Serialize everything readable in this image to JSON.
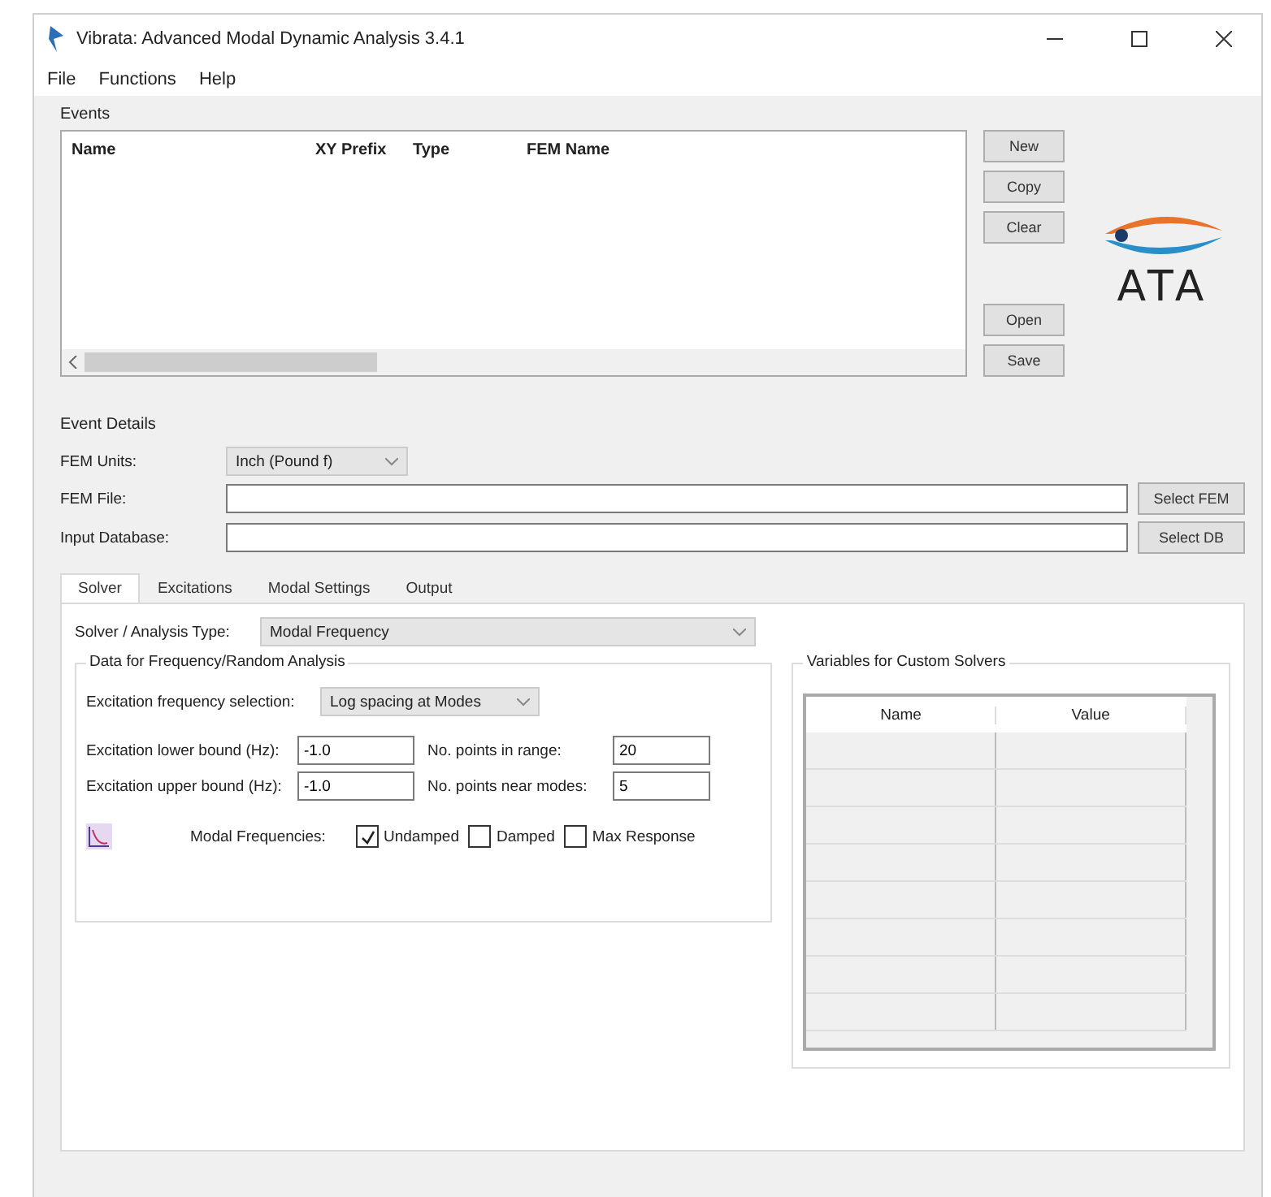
{
  "window": {
    "title": "Vibrata: Advanced Modal Dynamic Analysis 3.4.1"
  },
  "menu": [
    "File",
    "Functions",
    "Help"
  ],
  "events": {
    "title": "Events",
    "columns": [
      "Name",
      "XY Prefix",
      "Type",
      "FEM Name"
    ],
    "buttons_top": [
      "New",
      "Copy",
      "Clear"
    ],
    "buttons_bottom": [
      "Open",
      "Save"
    ]
  },
  "logo": {
    "text": "ATA"
  },
  "event_details": {
    "title": "Event Details",
    "fields": [
      {
        "kind": "dropdown",
        "label": "FEM Units:",
        "value": "Inch (Pound f)"
      },
      {
        "kind": "file",
        "label": "FEM File:",
        "button": "Select FEM"
      },
      {
        "kind": "file",
        "label": "Input Database:",
        "button": "Select DB"
      }
    ]
  },
  "tabs": [
    {
      "label": "Solver",
      "selected": true
    },
    {
      "label": "Excitations",
      "selected": false
    },
    {
      "label": "Modal Settings",
      "selected": false
    },
    {
      "label": "Output",
      "selected": false
    }
  ],
  "solver": {
    "label": "Solver / Analysis Type:",
    "value": "Modal Frequency"
  },
  "frequency": {
    "title": "Data for Frequency/Random Analysis",
    "selection_label": "Excitation frequency selection:",
    "selection_value": "Log spacing at Modes",
    "fields": [
      {
        "label": "Excitation lower bound (Hz):",
        "value": "-1.0"
      },
      {
        "label": "No. points in range:",
        "value": "20"
      },
      {
        "label": "Excitation upper bound (Hz):",
        "value": "-1.0"
      },
      {
        "label": "No. points near modes:",
        "value": "5"
      }
    ],
    "checks_label": "Modal Frequencies:",
    "checkboxes": [
      {
        "label": "Undamped",
        "checked": true
      },
      {
        "label": "Damped",
        "checked": false
      },
      {
        "label": "Max Response",
        "checked": false
      }
    ]
  },
  "variables": {
    "title": "Variables for Custom Solvers",
    "columns": [
      "Name",
      "Value"
    ]
  }
}
